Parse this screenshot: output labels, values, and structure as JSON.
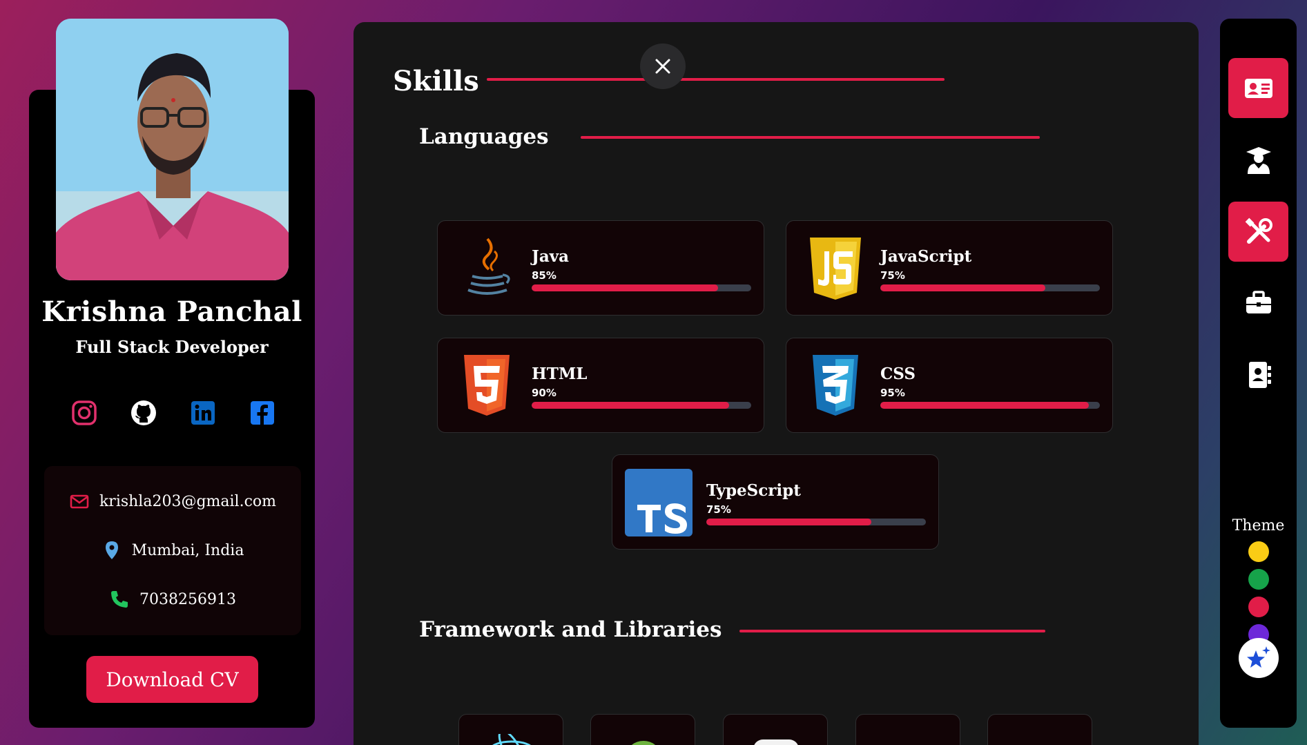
{
  "profile": {
    "name": "Krishna Panchal",
    "role": "Full Stack Developer",
    "photo_alt": "Profile photo",
    "socials": [
      {
        "icon": "instagram-icon",
        "color": "#e1306c"
      },
      {
        "icon": "github-icon",
        "color": "#ffffff"
      },
      {
        "icon": "linkedin-icon",
        "color": "#0a66c2"
      },
      {
        "icon": "facebook-icon",
        "color": "#1877f2"
      }
    ],
    "contact": {
      "email": "krishla203@gmail.com",
      "location": "Mumbai, India",
      "phone": "7038256913"
    },
    "download_label": "Download CV"
  },
  "main": {
    "section_title": "Skills",
    "languages_title": "Languages",
    "frameworks_title": "Framework and Libraries",
    "skills": [
      {
        "name": "Java",
        "percent_label": "85%",
        "percent": 0.85,
        "icon": "java-icon"
      },
      {
        "name": "JavaScript",
        "percent_label": "75%",
        "percent": 0.75,
        "icon": "javascript-icon"
      },
      {
        "name": "HTML",
        "percent_label": "90%",
        "percent": 0.9,
        "icon": "html5-icon"
      },
      {
        "name": "CSS",
        "percent_label": "95%",
        "percent": 0.95,
        "icon": "css3-icon"
      },
      {
        "name": "TypeScript",
        "percent_label": "75%",
        "percent": 0.75,
        "icon": "typescript-icon"
      }
    ]
  },
  "nav": {
    "items": [
      {
        "icon": "id-card-icon",
        "active": true
      },
      {
        "icon": "graduate-icon",
        "active": false
      },
      {
        "icon": "tools-icon",
        "active": true
      },
      {
        "icon": "briefcase-icon",
        "active": false
      },
      {
        "icon": "contact-book-icon",
        "active": false
      }
    ],
    "theme_label": "Theme",
    "theme_colors": [
      "#facc15",
      "#16a34a",
      "#e11d48",
      "#6d28d9"
    ]
  },
  "colors": {
    "accent": "#e11d48"
  }
}
